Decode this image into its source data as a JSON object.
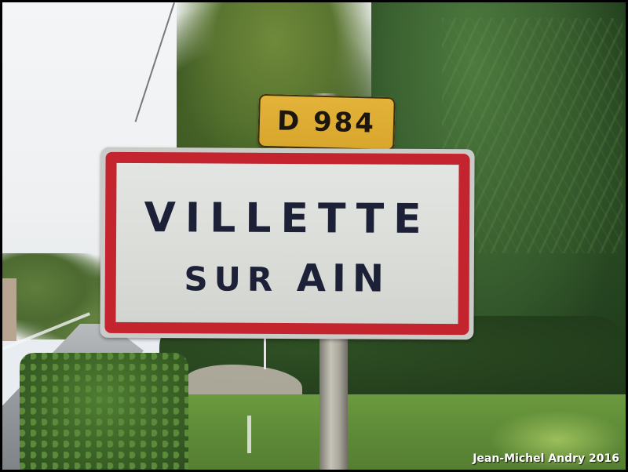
{
  "route_plate": {
    "text": "D 984"
  },
  "town_sign": {
    "line1": "VILLETTE",
    "line2_prefix": "SUR",
    "line2_main": "AIN"
  },
  "credit": "Jean-Michel Andry 2016",
  "colors": {
    "sign_border": "#c4242e",
    "route_plate": "#e3b33a",
    "sign_text": "#1d2138"
  }
}
